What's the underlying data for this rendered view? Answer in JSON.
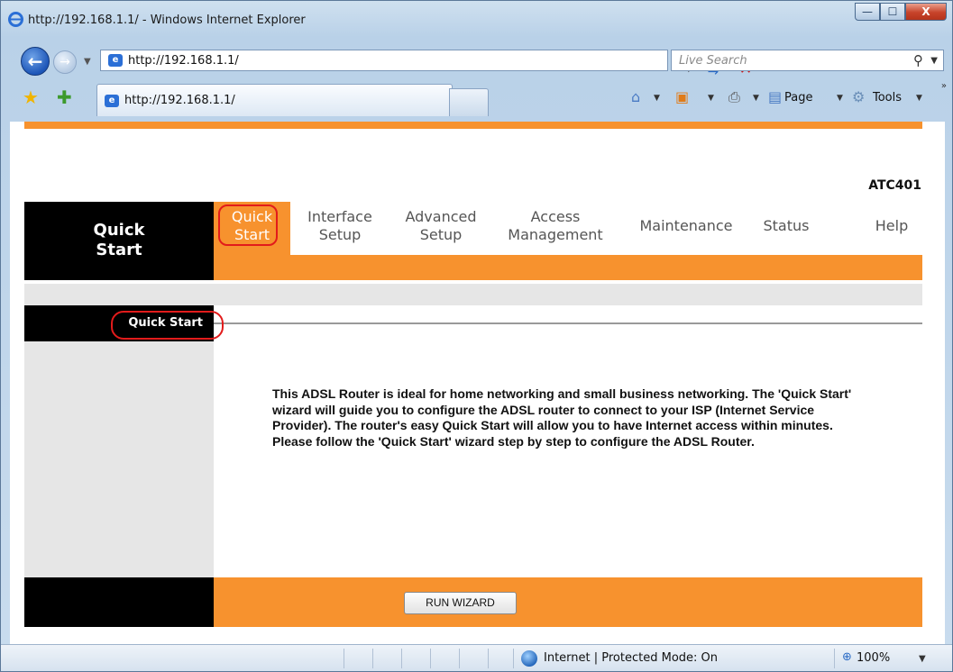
{
  "window": {
    "title": "http://192.168.1.1/ - Windows Internet Explorer",
    "minimize": "—",
    "maximize": "☐",
    "close": "X"
  },
  "toolbar": {
    "address": "http://192.168.1.1/",
    "search_placeholder": "Live Search"
  },
  "favorites_bar": {
    "tab_title": "http://192.168.1.1/",
    "page_menu": "Page",
    "tools_menu": "Tools"
  },
  "router": {
    "model": "ATC401",
    "section_title_line1": "Quick",
    "section_title_line2": "Start",
    "nav": [
      {
        "line1": "Quick",
        "line2": "Start"
      },
      {
        "line1": "Interface",
        "line2": "Setup"
      },
      {
        "line1": "Advanced",
        "line2": "Setup"
      },
      {
        "line1": "Access",
        "line2": "Management"
      },
      {
        "line1": "Maintenance",
        "line2": ""
      },
      {
        "line1": "Status",
        "line2": ""
      },
      {
        "line1": "Help",
        "line2": ""
      }
    ],
    "sub_label": "Quick Start",
    "description": "This ADSL Router is ideal for home networking and small business networking. The 'Quick Start' wizard will guide you to configure the ADSL router to connect to your ISP (Internet Service Provider). The router's easy Quick Start will allow you to have Internet access within minutes. Please follow the 'Quick Start' wizard step by step to configure the ADSL Router.",
    "wizard_button": "RUN WIZARD"
  },
  "statusbar": {
    "zone": "Internet | Protected Mode: On",
    "zoom": "100%"
  },
  "colors": {
    "accent_orange": "#f7922e",
    "highlight_red": "#e21b1b"
  }
}
